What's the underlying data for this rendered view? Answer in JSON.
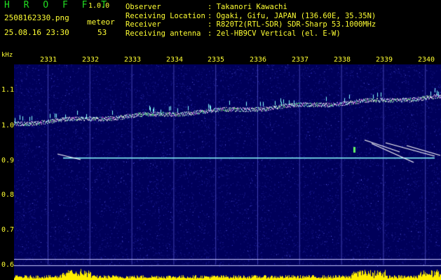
{
  "header": {
    "brand": "H R O F F T",
    "version": "1.0.0",
    "filename": "2508162330.png",
    "mode": "meteor",
    "timestamp": "25.08.16 23:30",
    "count": "53"
  },
  "meta": [
    {
      "key": "Observer",
      "value": ": Takanori Kawachi"
    },
    {
      "key": "Receiving Location",
      "value": ": Ogaki, Gifu, JAPAN (136.60E, 35.35N)"
    },
    {
      "key": "Receiver",
      "value": ": R820T2(RTL-SDR) SDR-Sharp 53.1000MHz"
    },
    {
      "key": "Receiving antenna",
      "value": ": 2el-HB9CV Vertical (el. E-W)"
    }
  ],
  "plot": {
    "unit": "kHz",
    "x_ticks": [
      "2331",
      "2332",
      "2333",
      "2334",
      "2335",
      "2336",
      "2337",
      "2338",
      "2339",
      "2340"
    ],
    "y_ticks": [
      "1.1",
      "1.0",
      "0.9",
      "0.8",
      "0.7",
      "0.6"
    ],
    "colors": {
      "background": "#00005a",
      "noise": "#3030c0",
      "carrier": "#88ffff",
      "echo": "#ffffff",
      "activity": "#ffee00",
      "label": "#ffff33"
    }
  }
}
